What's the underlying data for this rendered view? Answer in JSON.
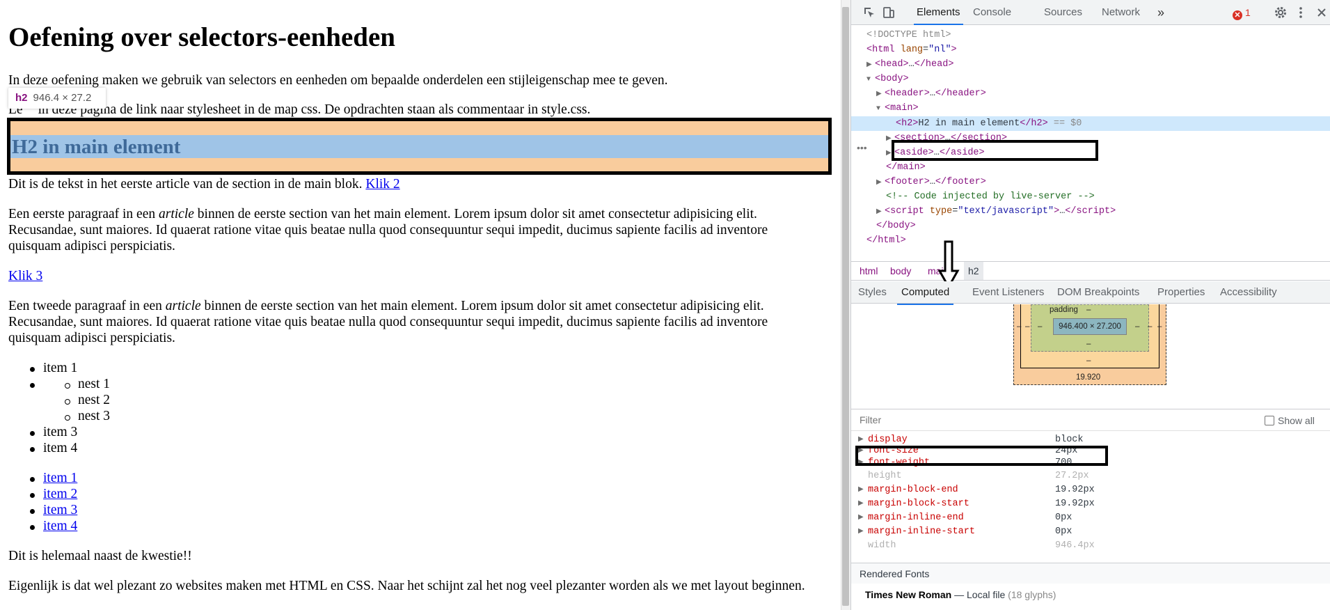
{
  "page": {
    "title": "Oefening over selectors-eenheden",
    "intro": "In deze oefening maken we gebruik van selectors en eenheden om bepaalde onderdelen een stijleigenschap mee te geven.",
    "line2_start": "Le",
    "line2_rest": "in deze pagina de link naar stylesheet in de map css. De opdrachten staan als commentaar in style.css.",
    "h2": "H2 in main element",
    "article_text": "Dit is de tekst in het eerste article van de section in de main blok.",
    "klik2": "Klik 2",
    "para1_a": "Een eerste paragraaf in een",
    "para1_em": "article",
    "para1_b": "binnen de eerste section van het main element. Lorem ipsum dolor sit amet consectetur adipisicing elit.",
    "para1_c": "Recusandae, sunt maiores. Id quaerat ratione vitae quis beatae nulla quod consequuntur sequi impedit, ducimus sapiente facilis ad inventore",
    "para1_d": "quisquam adipisci perspiciatis.",
    "klik3": "Klik 3",
    "para2_a": "Een tweede paragraaf in een",
    "para2_em": "article",
    "para2_b": "binnen de eerste section van het main element. Lorem ipsum dolor sit amet consectetur adipisicing elit.",
    "para2_c": "Recusandae, sunt maiores. Id quaerat ratione vitae quis beatae nulla quod consequuntur sequi impedit, ducimus sapiente facilis ad inventore",
    "para2_d": "quisquam adipisci perspiciatis.",
    "list1": [
      "item 1",
      "",
      "item 3",
      "item 4"
    ],
    "nested": [
      "nest 1",
      "nest 2",
      "nest 3"
    ],
    "list2": [
      "item 1",
      "item 2",
      "item 3",
      "item 4"
    ],
    "naast": "Dit is helemaal naast de kwestie!!",
    "eigenlijk": "Eigenlijk is dat wel plezant zo websites maken met HTML en CSS. Naar het schijnt zal het nog veel plezanter worden als we met layout beginnen.",
    "tooltip_tag": "h2",
    "tooltip_size": "946.4 × 27.2"
  },
  "devtools": {
    "tabs": [
      "Elements",
      "Console",
      "Sources",
      "Network"
    ],
    "more_tabs": "»",
    "error_count": "1",
    "error_icon": "✕",
    "dom": {
      "doctype": "<!DOCTYPE html>",
      "html_open_tag": "<html",
      "html_attr": "lang",
      "html_val": "\"nl\"",
      "head": "…",
      "body": "<body>",
      "header": "…",
      "main": "<main>",
      "h2_text": "H2 in main element",
      "h2_suffix": "== $0",
      "section": "…",
      "aside": "…",
      "main_close": "</main>",
      "footer": "…",
      "comment": "<!-- Code injected by live-server -->",
      "script_attr": "type",
      "script_val": "\"text/javascript\"",
      "script_inner": "…",
      "body_close": "</body>",
      "html_close": "</html>"
    },
    "breadcrumbs": [
      "html",
      "body",
      "main",
      "h2"
    ],
    "subtabs": [
      "Styles",
      "Computed",
      "Event Listeners",
      "DOM Breakpoints",
      "Properties",
      "Accessibility"
    ],
    "box_model": {
      "padding_label": "padding",
      "padding_top": "–",
      "content_size": "946.400 × 27.200",
      "dash": "–",
      "margin_bottom": "19.920"
    },
    "filter_placeholder": "Filter",
    "show_all": "Show all",
    "properties": [
      {
        "name": "display",
        "value": "block"
      },
      {
        "name": "font-size",
        "value": "24px"
      },
      {
        "name": "font-weight",
        "value": "700"
      },
      {
        "name": "height",
        "value": "27.2px"
      },
      {
        "name": "margin-block-end",
        "value": "19.92px"
      },
      {
        "name": "margin-block-start",
        "value": "19.92px"
      },
      {
        "name": "margin-inline-end",
        "value": "0px"
      },
      {
        "name": "margin-inline-start",
        "value": "0px"
      },
      {
        "name": "width",
        "value": "946.4px"
      }
    ],
    "rendered_fonts_title": "Rendered Fonts",
    "font_name": "Times New Roman",
    "font_sep": "—",
    "font_source": "Local file",
    "font_glyphs": "(18 glyphs)"
  }
}
